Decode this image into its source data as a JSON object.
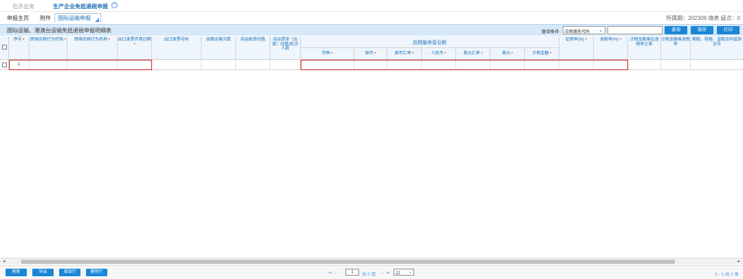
{
  "top_tabs": {
    "inactive": "在办业务",
    "active": "生产企业免抵退税申报"
  },
  "sub_tabs": [
    "申报主页",
    "附件",
    "国际运输申报"
  ],
  "period": "所属期：202309  填表  疑点：0",
  "table_title": "国际运输、港澳台运输免抵退税申报明细表",
  "query": {
    "label": "查询条件",
    "selected": "应税服务代码",
    "button": "查询"
  },
  "toolbar": {
    "save": "保存",
    "print": "打印"
  },
  "required_mark": "•",
  "columns": [
    {
      "label": "序号",
      "req": true
    },
    {
      "label": "跨境应税行为代码",
      "req": true
    },
    {
      "label": "跨境应税行为名称",
      "req": true
    },
    {
      "label": "出口发票开具日期",
      "req": true
    },
    {
      "label": "出口发票号码",
      "req": false
    },
    {
      "label": "本期运输次数",
      "req": false
    },
    {
      "label": "自运舱单份数",
      "req": false
    },
    {
      "label": "自运提单（运单）份数/航次人数",
      "req": false
    },
    {
      "label": "征税率(%)",
      "req": true
    },
    {
      "label": "退税率(%)",
      "req": true
    },
    {
      "label": "计税金额乘征退税率之差",
      "req": false
    },
    {
      "label": "计税金额乘退税率",
      "req": false
    },
    {
      "label": "期租、程租、湿租合同或协议号",
      "req": false
    }
  ],
  "group_header": "应税服务营业额",
  "group_columns": [
    {
      "label": "币种",
      "req": true
    },
    {
      "label": "原币",
      "req": true
    },
    {
      "label": "原币汇率",
      "req": true
    },
    {
      "label": "人民币",
      "req": true
    },
    {
      "label": "美元汇率",
      "req": true
    },
    {
      "label": "美元",
      "req": true
    },
    {
      "label": "计税金额",
      "req": true
    }
  ],
  "row": {
    "seq": "1"
  },
  "bottom_buttons": {
    "refresh": "刷新",
    "export": "导出",
    "add_row": "增加行",
    "delete_row": "删除行"
  },
  "pager": {
    "nav_left": "⇤  ←",
    "page_input": "1",
    "total": "共 0 页",
    "nav_right": "→  ⇥",
    "page_size": "22"
  },
  "record_info": "1 - 1   共 1 条"
}
